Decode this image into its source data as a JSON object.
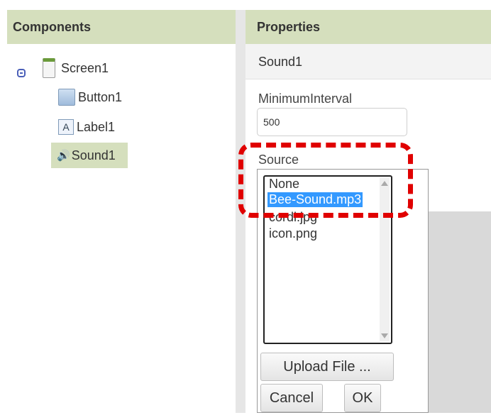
{
  "components": {
    "header": "Components",
    "tree": [
      {
        "label": "Screen1",
        "icon": "screen-icon"
      },
      {
        "label": "Button1",
        "icon": "button-icon"
      },
      {
        "label": "Label1",
        "icon": "label-icon",
        "icon_glyph": "A"
      },
      {
        "label": "Sound1",
        "icon": "speaker-icon",
        "icon_glyph": "🔊",
        "selected": true
      }
    ]
  },
  "properties": {
    "header": "Properties",
    "component_name": "Sound1",
    "minimum_interval": {
      "label": "MinimumInterval",
      "value": "500"
    },
    "source": {
      "label": "Source",
      "options": [
        "None",
        "Bee-Sound.mp3",
        "cordi.jpg",
        "icon.png"
      ],
      "selected": "Bee-Sound.mp3",
      "upload_label": "Upload File ...",
      "cancel_label": "Cancel",
      "ok_label": "OK"
    }
  },
  "colors": {
    "header_bg": "#d5dfbd",
    "selection_blue": "#3399ff",
    "annotation_red": "#e00000"
  }
}
